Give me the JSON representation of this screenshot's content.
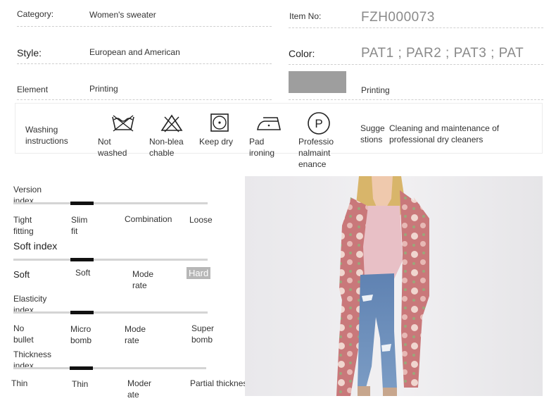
{
  "info": {
    "category_label": "Category:",
    "category_value": "Women's sweater",
    "item_no_label": "Item No:",
    "item_no_value": "FZH000073",
    "style_label": "Style:",
    "style_value": "European and American",
    "color_label": "Color:",
    "color_value": "PAT1 ; PAR2 ; PAT3 ; PAT",
    "element_label": "Element",
    "element_value": "Printing",
    "pattern_value": "Printing"
  },
  "care": {
    "washing_label": [
      "Washing",
      "instructions"
    ],
    "icons": [
      {
        "icon": "no-wash-icon",
        "lines": [
          "Not",
          "washed"
        ]
      },
      {
        "icon": "no-bleach-icon",
        "lines": [
          "Non-blea",
          "chable"
        ]
      },
      {
        "icon": "tumble-dry-icon",
        "lines": [
          "Keep dry"
        ]
      },
      {
        "icon": "iron-icon",
        "lines": [
          "Pad",
          "ironing"
        ]
      },
      {
        "icon": "professional-clean-icon",
        "lines": [
          "Professio",
          "nalmaint",
          "enance"
        ]
      }
    ],
    "suggestions_label": [
      "Sugge",
      "stions"
    ],
    "suggestions_text": [
      "Cleaning and maintenance of",
      "professional dry cleaners"
    ]
  },
  "indexes": {
    "version": {
      "title": [
        "Version",
        "index"
      ],
      "options": [
        [
          "Tight",
          "fitting"
        ],
        [
          "Slim",
          "fit"
        ],
        [
          "Combination"
        ],
        [
          "Loose"
        ]
      ],
      "selected": 1
    },
    "soft": {
      "title": [
        "Soft index"
      ],
      "options": [
        [
          "Soft"
        ],
        [
          "Soft"
        ],
        [
          "Mode",
          "rate"
        ],
        [
          "Hard"
        ]
      ],
      "selected": 1
    },
    "elasticity": {
      "title": [
        "Elasticity",
        "index"
      ],
      "options": [
        [
          "No",
          "bullet"
        ],
        [
          "Micro",
          "bomb"
        ],
        [
          "Mode",
          "rate"
        ],
        [
          "Super",
          "bomb"
        ]
      ],
      "selected": 1
    },
    "thickness": {
      "title": [
        "Thickness",
        "index"
      ],
      "options": [
        [
          "Thin"
        ],
        [
          "Thin"
        ],
        [
          "Moder",
          "ate"
        ],
        [
          "Partial thickness"
        ]
      ],
      "selected": 1
    }
  },
  "colors": {
    "cardigan": "#c9787a",
    "top": "#e8c0c6",
    "jeans": "#6e8fb8"
  }
}
